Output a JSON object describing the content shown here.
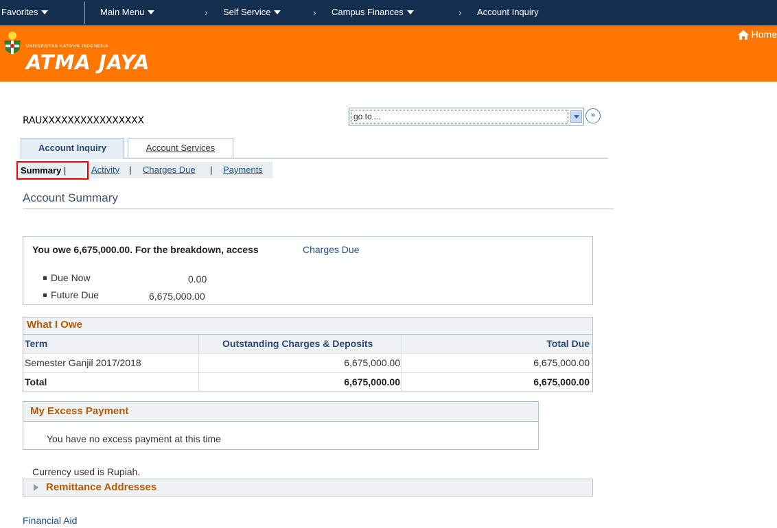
{
  "topnav": {
    "favorites": "Favorites",
    "main_menu": "Main Menu",
    "breadcrumbs": [
      "Self Service",
      "Campus Finances",
      "Account Inquiry"
    ]
  },
  "banner": {
    "university_small": "UNIVERSITAS KATOLIK INDONESIA",
    "university_name": "ATMA JAYA",
    "home": "Home"
  },
  "student_id": "RAUXXXXXXXXXXXXXXXX",
  "goto": {
    "value": "go to ..."
  },
  "tabs": [
    {
      "label": "Account Inquiry",
      "active": true
    },
    {
      "label": "Account Services",
      "active": false
    }
  ],
  "subnav": {
    "current": "Summary",
    "links": [
      "Activity",
      "Charges Due",
      "Payments"
    ]
  },
  "page_title": "Account Summary",
  "owe": {
    "message": "You owe 6,675,000.00.  For the breakdown, access",
    "link": "Charges Due",
    "due_now_label": "Due Now",
    "due_now_value": "0.00",
    "future_due_label": "Future Due",
    "future_due_value": "6,675,000.00"
  },
  "what_i_owe": {
    "title": "What I Owe",
    "headers": [
      "Term",
      "Outstanding Charges & Deposits",
      "Total Due"
    ],
    "rows": [
      [
        "Semester Ganjil 2017/2018",
        "6,675,000.00",
        "6,675,000.00"
      ]
    ],
    "total": [
      "Total",
      "6,675,000.00",
      "6,675,000.00"
    ]
  },
  "excess": {
    "title": "My Excess Payment",
    "message": "You have no excess payment at this time"
  },
  "currency_note": "Currency used is Rupiah.",
  "remittance": "Remittance Addresses",
  "financial_aid": "Financial Aid",
  "colors": {
    "nav_bg": "#152f4f",
    "banner_bg": "#ff7700",
    "section_title": "#b35b00",
    "link": "#1c4f8c",
    "highlight": "#e00000"
  }
}
